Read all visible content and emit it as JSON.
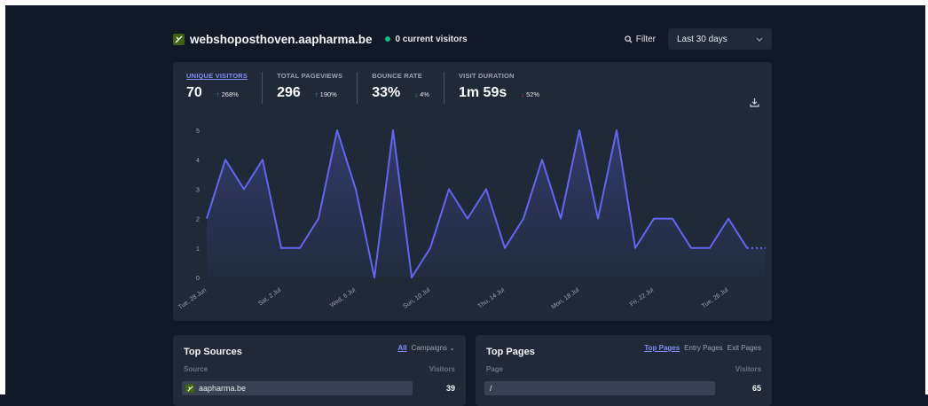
{
  "header": {
    "site": "webshoposthoven.aapharma.be",
    "current_visitors": "0 current visitors",
    "filter_label": "Filter",
    "period_label": "Last 30 days"
  },
  "metrics": [
    {
      "label": "UNIQUE VISITORS",
      "value": "70",
      "change": "268%",
      "direction": "up"
    },
    {
      "label": "TOTAL PAGEVIEWS",
      "value": "296",
      "change": "190%",
      "direction": "up"
    },
    {
      "label": "BOUNCE RATE",
      "value": "33%",
      "change": "4%",
      "direction": "down-good"
    },
    {
      "label": "VISIT DURATION",
      "value": "1m 59s",
      "change": "52%",
      "direction": "down-bad"
    }
  ],
  "chart_data": {
    "type": "area",
    "x_tick_labels": [
      "Tue, 28 Jun",
      "Sat, 2 Jul",
      "Wed, 6 Jul",
      "Sun, 10 Jul",
      "Thu, 14 Jul",
      "Mon, 18 Jul",
      "Fri, 22 Jul",
      "Tue, 26 Jul"
    ],
    "values": [
      2,
      4,
      3,
      4,
      1,
      1,
      2,
      5,
      3,
      0,
      5,
      0,
      1,
      3,
      2,
      3,
      1,
      2,
      4,
      2,
      5,
      2,
      5,
      1,
      2,
      2,
      1,
      1,
      2,
      1,
      1
    ],
    "y_ticks": [
      0,
      1,
      2,
      3,
      4,
      5
    ],
    "ylim": [
      0,
      5
    ],
    "line_color": "#6366f1",
    "dotted_last_segment": true
  },
  "top_sources": {
    "title": "Top Sources",
    "tab_all": "All",
    "tab_campaigns": "Campaigns",
    "col_source": "Source",
    "col_visitors": "Visitors",
    "rows": [
      {
        "label": "aapharma.be",
        "value": "39"
      }
    ]
  },
  "top_pages": {
    "title": "Top Pages",
    "tab_top": "Top Pages",
    "tab_entry": "Entry Pages",
    "tab_exit": "Exit Pages",
    "col_page": "Page",
    "col_visitors": "Visitors",
    "rows": [
      {
        "label": "/",
        "value": "65"
      }
    ]
  },
  "colors": {
    "background": "#111827",
    "card": "#1f2937",
    "accent": "#818cf8",
    "positive": "#10b981",
    "negative": "#ef4444"
  }
}
